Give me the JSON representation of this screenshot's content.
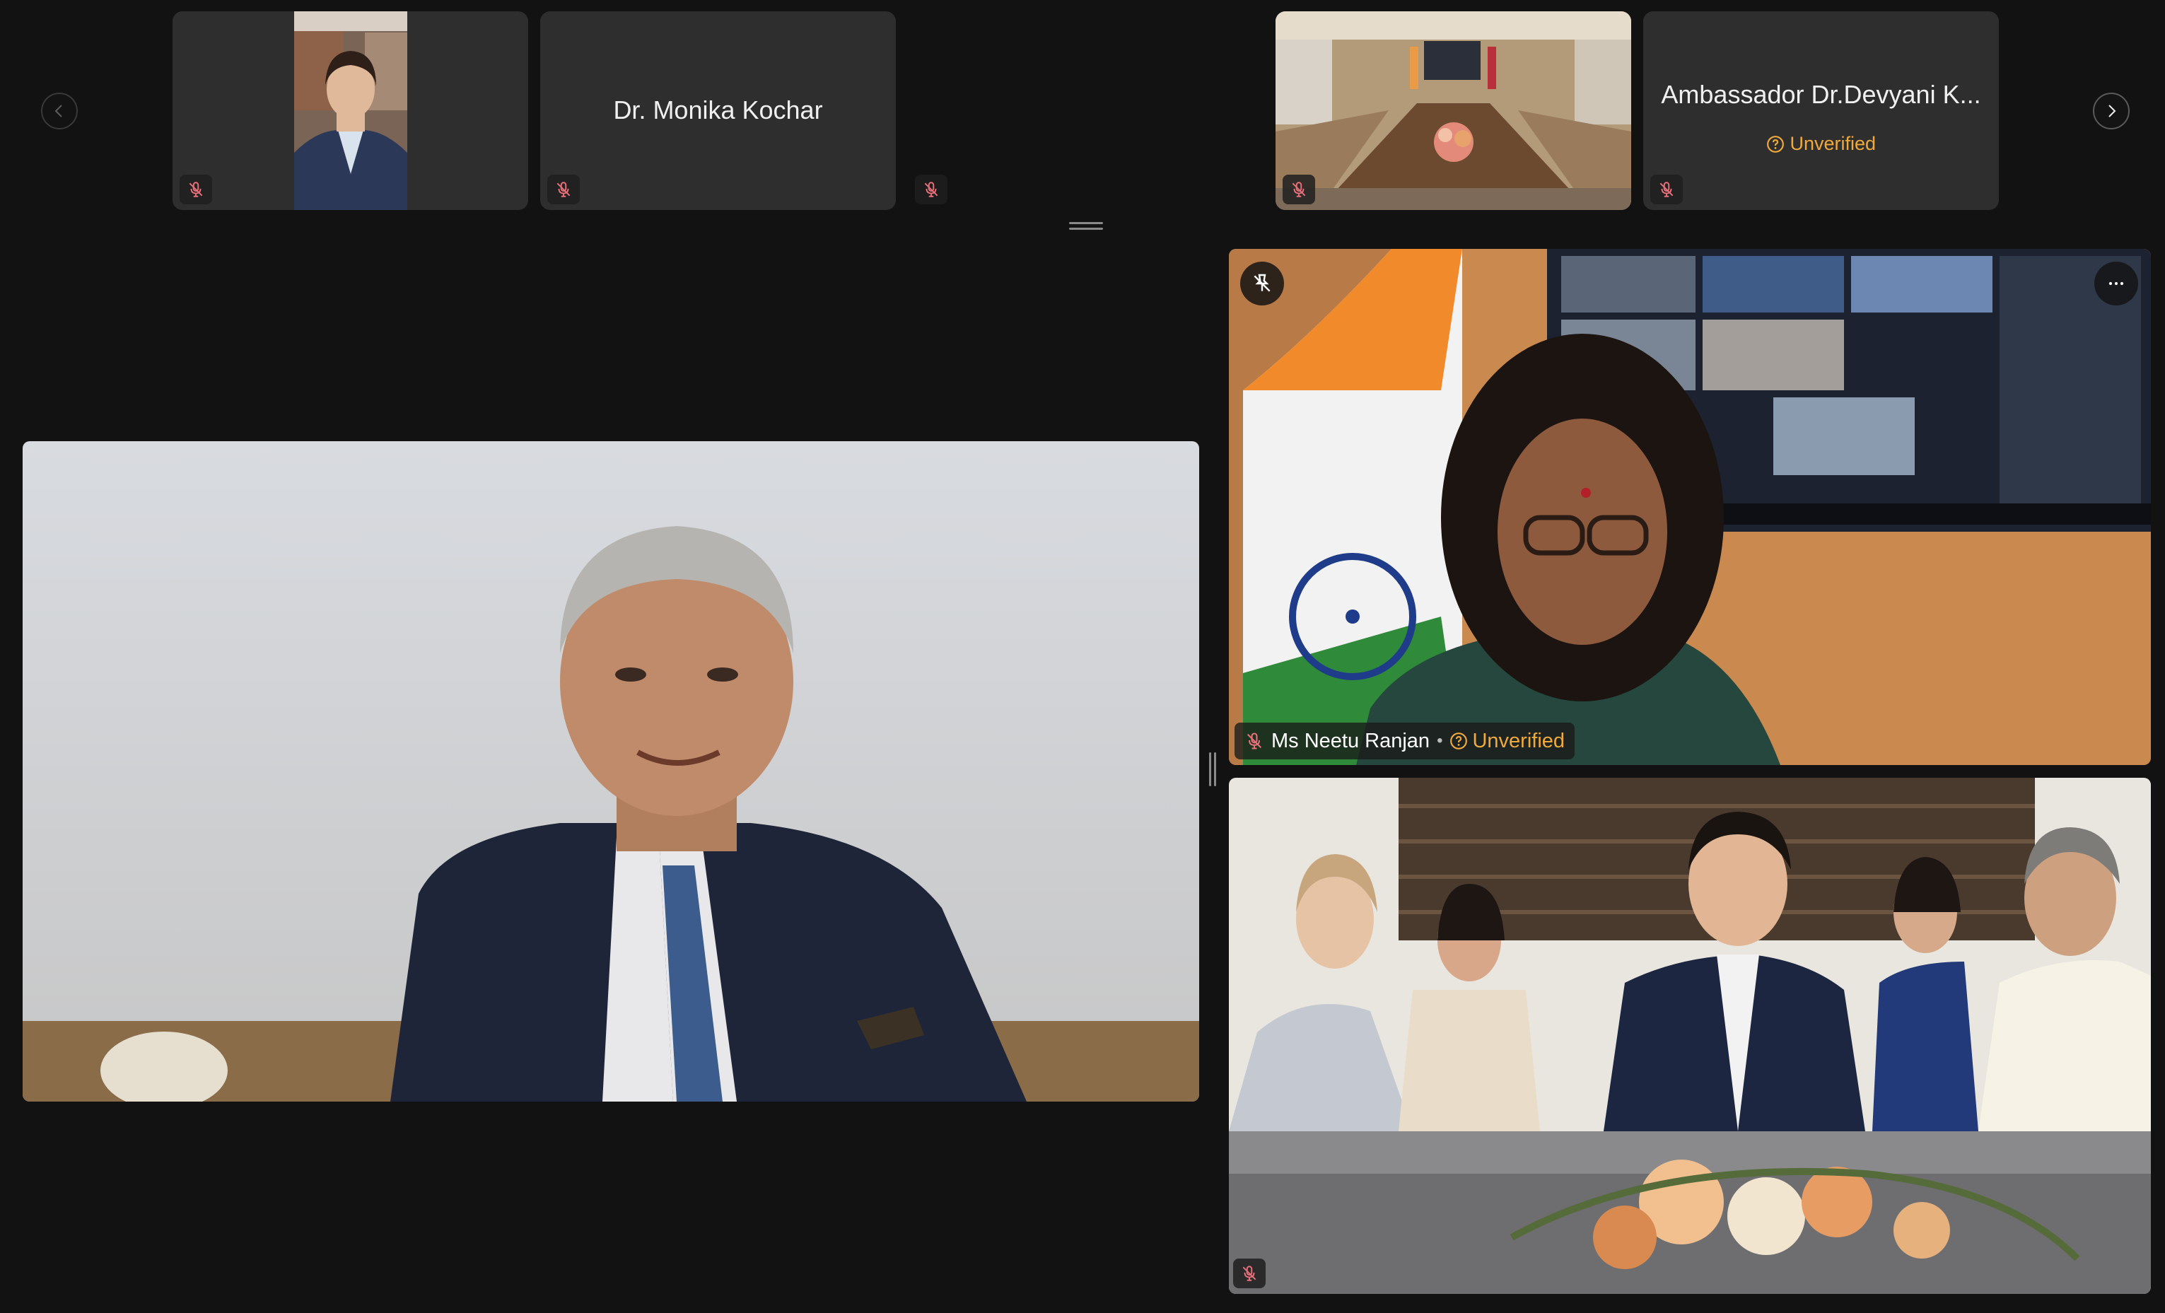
{
  "strip": {
    "tiles": [
      {
        "name": "",
        "kind": "video-person",
        "muted": true
      },
      {
        "name": "Dr. Monika Kochar",
        "badge": "",
        "muted": true
      },
      {
        "name": "",
        "kind": "empty",
        "muted": true
      },
      {
        "name": "",
        "kind": "video-room",
        "muted": true
      },
      {
        "name": "Ambassador Dr.Devyani K...",
        "badge": "Unverified",
        "muted": true
      }
    ]
  },
  "main": {
    "left_speaker": {
      "name": ""
    },
    "right_top": {
      "name": "Ms Neetu Ranjan",
      "separator": "•",
      "badge": "Unverified"
    },
    "right_bottom": {
      "name": ""
    }
  },
  "colors": {
    "background": "#121212",
    "tile": "#2e2e2e",
    "unverified": "#f0a93b",
    "mic_muted": "#e8707a"
  },
  "icons": {
    "prev": "chevron-left-icon",
    "next": "chevron-right-icon",
    "mic": "mic-off-icon",
    "pin": "unpin-icon",
    "more": "more-options-icon",
    "unverified": "question-circle-icon"
  }
}
